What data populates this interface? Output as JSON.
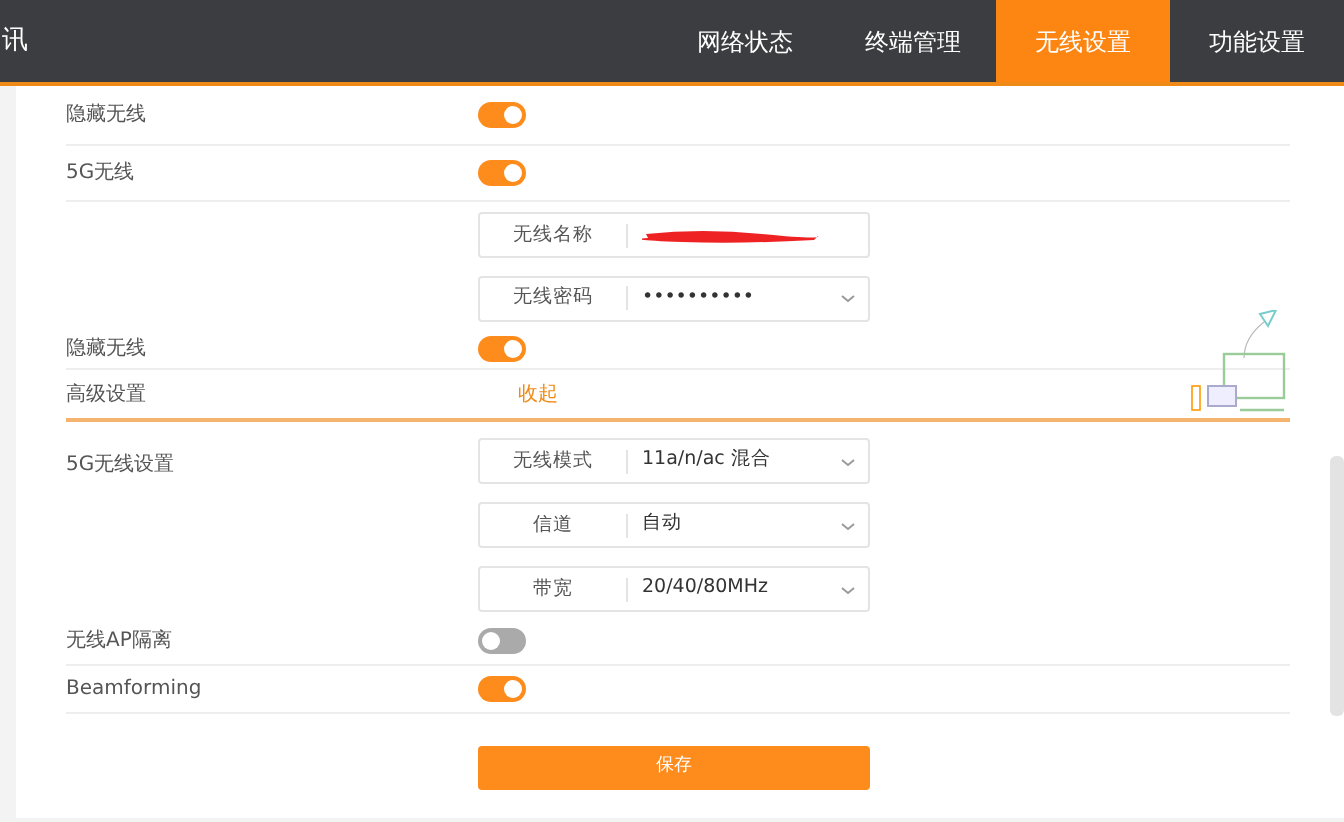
{
  "header": {
    "brand": "讯",
    "tabs": [
      {
        "label": "网络状态",
        "selected": false
      },
      {
        "label": "终端管理",
        "selected": false
      },
      {
        "label": "无线设置",
        "selected": true
      },
      {
        "label": "功能设置",
        "selected": false
      }
    ]
  },
  "rows": [
    {
      "kind": "toggle",
      "label": "隐藏无线",
      "on": true
    },
    {
      "kind": "toggle",
      "label": "5G无线",
      "on": true
    },
    {
      "kind": "field",
      "field_label": "无线名称",
      "redacted": true
    },
    {
      "kind": "field",
      "field_label": "无线密码",
      "value": "••••••••••",
      "password": true
    },
    {
      "kind": "toggle",
      "label": "隐藏无线",
      "on": true
    },
    {
      "kind": "section",
      "label": "高级设置",
      "link": "收起"
    },
    {
      "kind": "selects",
      "label": "5G无线设置",
      "selects": [
        {
          "field_label": "无线模式",
          "value": "11a/n/ac 混合"
        },
        {
          "field_label": "信道",
          "value": "自动"
        },
        {
          "field_label": "带宽",
          "value": "20/40/80MHz"
        }
      ]
    },
    {
      "kind": "toggle",
      "label": "无线AP隔离",
      "on": false
    },
    {
      "kind": "toggle",
      "label": "Beamforming",
      "on": true
    }
  ],
  "save_button": "保存"
}
